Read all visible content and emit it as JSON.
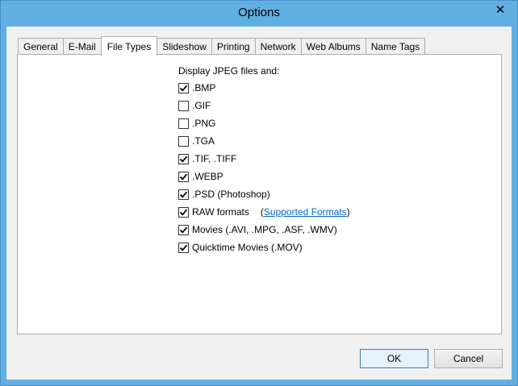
{
  "window": {
    "title": "Options",
    "close_glyph": "✕"
  },
  "tabs": [
    {
      "label": "General"
    },
    {
      "label": "E-Mail"
    },
    {
      "label": "File Types"
    },
    {
      "label": "Slideshow"
    },
    {
      "label": "Printing"
    },
    {
      "label": "Network"
    },
    {
      "label": "Web Albums"
    },
    {
      "label": "Name Tags"
    }
  ],
  "active_tab": "File Types",
  "file_types": {
    "heading": "Display JPEG files and:",
    "options": [
      {
        "label": ".BMP",
        "checked": true
      },
      {
        "label": ".GIF",
        "checked": false
      },
      {
        "label": ".PNG",
        "checked": false
      },
      {
        "label": ".TGA",
        "checked": false
      },
      {
        "label": ".TIF, .TIFF",
        "checked": true
      },
      {
        "label": ".WEBP",
        "checked": true
      },
      {
        "label": ".PSD (Photoshop)",
        "checked": true
      },
      {
        "label": "RAW formats",
        "checked": true
      },
      {
        "label": "Movies (.AVI, .MPG, .ASF, .WMV)",
        "checked": true
      },
      {
        "label": "Quicktime Movies (.MOV)",
        "checked": true
      }
    ],
    "raw_link": {
      "open": "(",
      "text": "Supported Formats",
      "close": ")"
    }
  },
  "buttons": {
    "ok": "OK",
    "cancel": "Cancel"
  },
  "colors": {
    "title_bar": "#60aee2",
    "link": "#0066cc",
    "dialog_bg": "#f0f0f0"
  },
  "icons": {
    "close": "close-icon",
    "check": "checkmark-icon"
  }
}
